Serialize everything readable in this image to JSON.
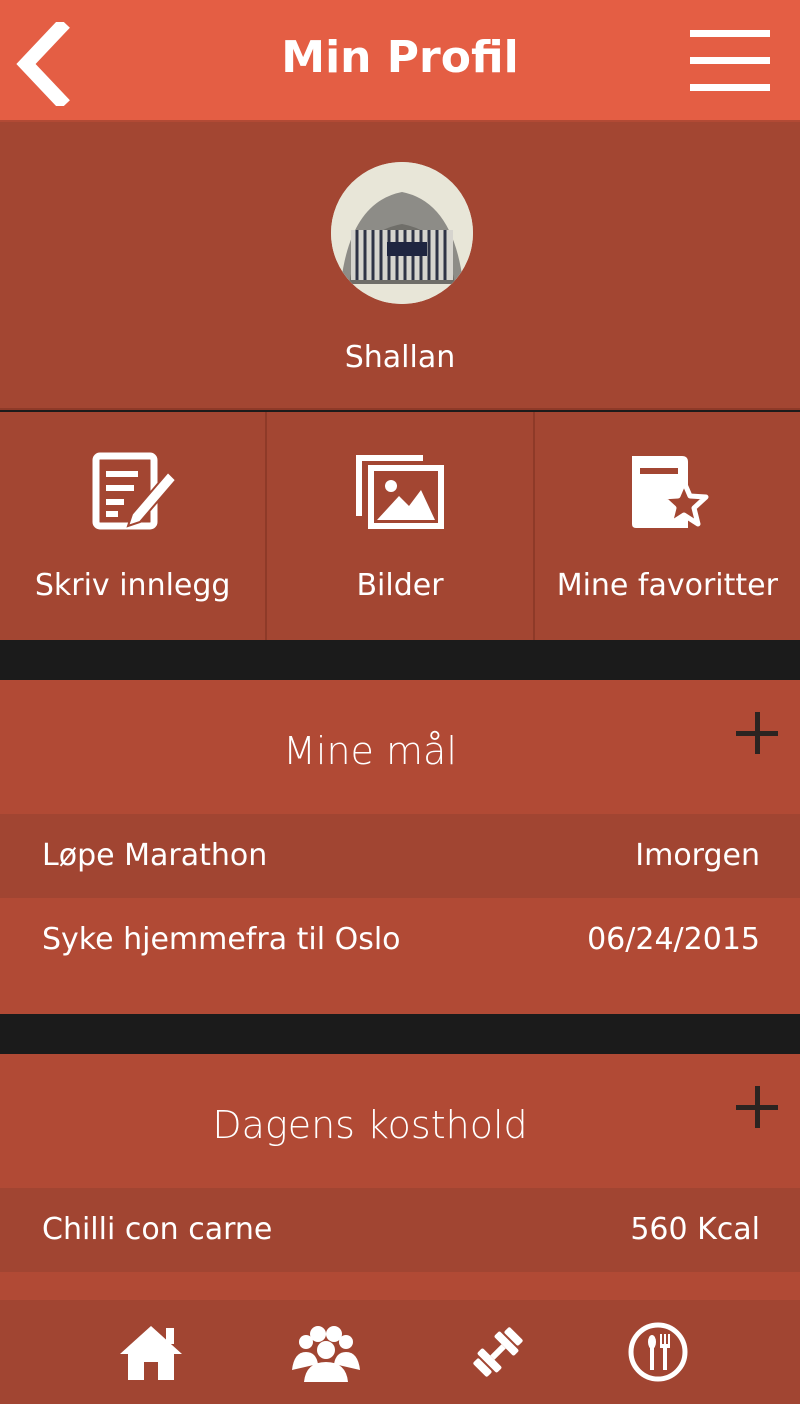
{
  "header": {
    "title": "Min Profil",
    "back_icon": "chevron-left-icon",
    "menu_icon": "hamburger-menu-icon"
  },
  "profile": {
    "name": "Shallan",
    "avatar_icon": "avatar-cap-photo"
  },
  "actions": [
    {
      "label": "Skriv innlegg",
      "icon": "edit-document-icon"
    },
    {
      "label": "Bilder",
      "icon": "images-icon"
    },
    {
      "label": "Mine favoritter",
      "icon": "favorite-book-icon"
    }
  ],
  "goals": {
    "title": "Mine mål",
    "rows": [
      {
        "name": "Løpe Marathon",
        "value": "Imorgen"
      },
      {
        "name": "Syke hjemmefra til Oslo",
        "value": "06/24/2015"
      }
    ]
  },
  "diet": {
    "title": "Dagens kosthold",
    "rows": [
      {
        "name": "Chilli con carne",
        "value": "560 Kcal"
      }
    ]
  },
  "bottom_nav": [
    {
      "icon": "home-icon"
    },
    {
      "icon": "group-icon"
    },
    {
      "icon": "dumbbell-icon"
    },
    {
      "icon": "cutlery-icon"
    }
  ],
  "colors": {
    "header": "#e45e44",
    "panel": "#a34632",
    "section": "#b14a35",
    "divider": "#1b1b1b"
  }
}
